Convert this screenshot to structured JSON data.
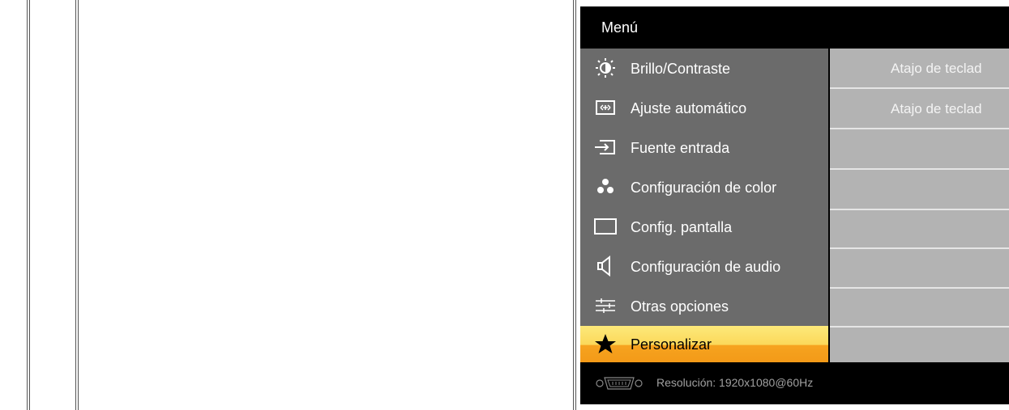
{
  "osd": {
    "title": "Menú",
    "menu_items": [
      {
        "label": "Brillo/Contraste",
        "icon": "brightness-icon"
      },
      {
        "label": "Ajuste automático",
        "icon": "auto-adjust-icon"
      },
      {
        "label": "Fuente entrada",
        "icon": "input-source-icon"
      },
      {
        "label": "Configuración de color",
        "icon": "color-dots-icon"
      },
      {
        "label": "Config. pantalla",
        "icon": "display-icon"
      },
      {
        "label": "Configuración de audio",
        "icon": "speaker-icon"
      },
      {
        "label": "Otras opciones",
        "icon": "sliders-icon"
      },
      {
        "label": "Personalizar",
        "icon": "star-icon",
        "selected": true
      }
    ],
    "right_rows": [
      "Atajo de teclad",
      "Atajo de teclad",
      "",
      "",
      "",
      "",
      "",
      ""
    ],
    "footer": {
      "resolution": "Resolución:  1920x1080@60Hz",
      "connector_icon": "vga-connector-icon"
    }
  },
  "colors": {
    "menu_bg": "#6b6b6b",
    "right_bg": "#b3b3b3",
    "selected_top": "#fde97a",
    "selected_bottom": "#f39a18"
  }
}
